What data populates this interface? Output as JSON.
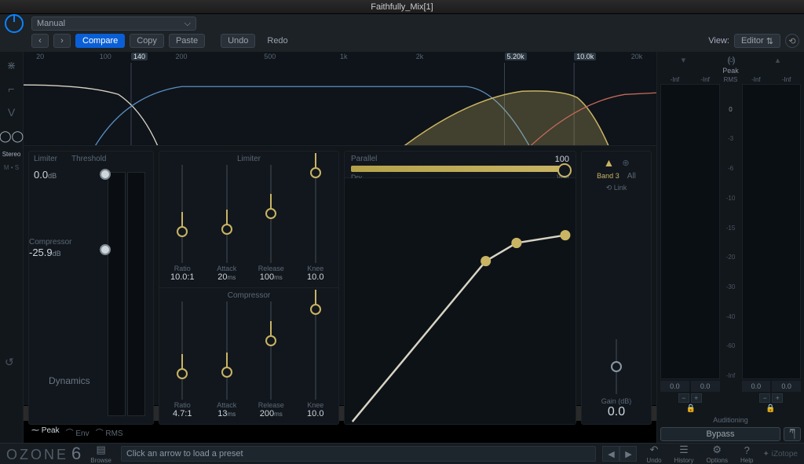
{
  "window": {
    "title": "Faithfully_Mix[1]"
  },
  "host": {
    "preset": "Manual",
    "buttons": {
      "compare": "Compare",
      "copy": "Copy",
      "paste": "Paste",
      "undo": "Undo",
      "redo": "Redo"
    },
    "view_label": "View:",
    "view_value": "Editor"
  },
  "freq": {
    "ticks": [
      {
        "pos": 2,
        "label": "20"
      },
      {
        "pos": 12,
        "label": "100"
      },
      {
        "pos": 17,
        "label": "140",
        "hot": true
      },
      {
        "pos": 24,
        "label": "200"
      },
      {
        "pos": 38,
        "label": "500"
      },
      {
        "pos": 50,
        "label": "1k"
      },
      {
        "pos": 62,
        "label": "2k"
      },
      {
        "pos": 76,
        "label": "5.20k",
        "hot": true
      },
      {
        "pos": 87,
        "label": "10.0k",
        "hot": true
      },
      {
        "pos": 96,
        "label": "20k"
      }
    ]
  },
  "threshold": {
    "section_limiter": "Limiter",
    "section_threshold": "Threshold",
    "limiter_value": "0.0",
    "limiter_unit": "dB",
    "section_compressor": "Compressor",
    "compressor_value": "-25.9",
    "compressor_unit": "dB"
  },
  "limiter": {
    "title": "Limiter",
    "params": [
      {
        "label": "Ratio",
        "value": "10.0:1"
      },
      {
        "label": "Attack",
        "value": "20",
        "unit": "ms"
      },
      {
        "label": "Release",
        "value": "100",
        "unit": "ms"
      },
      {
        "label": "Knee",
        "value": "10.0"
      }
    ]
  },
  "compressor": {
    "title": "Compressor",
    "params": [
      {
        "label": "Ratio",
        "value": "4.7:1"
      },
      {
        "label": "Attack",
        "value": "13",
        "unit": "ms"
      },
      {
        "label": "Release",
        "value": "200",
        "unit": "ms"
      },
      {
        "label": "Knee",
        "value": "10.0"
      }
    ]
  },
  "detect": {
    "peak": "Peak",
    "env": "Env",
    "rms": "RMS"
  },
  "parallel": {
    "title": "Parallel",
    "value": "100",
    "dry": "Dry",
    "wet": "Wet"
  },
  "band": {
    "band_label": "Band 3",
    "all_label": "All",
    "link": "Link",
    "gain_label": "Gain (dB)",
    "gain_value": "0.0"
  },
  "io": {
    "peak": "Peak",
    "rms": "RMS",
    "inf": "-Inf",
    "scale": [
      "0",
      "-3",
      "-6",
      "-10",
      "-15",
      "-20",
      "-30",
      "-40",
      "-60",
      "-Inf"
    ],
    "readout": "0.0",
    "auditioning": "Auditioning",
    "bypass": "Bypass"
  },
  "footer": {
    "logo_text": "OZONE",
    "logo_num": "6",
    "module": "Dynamics",
    "browse": "Browse",
    "preset_msg": "Click an arrow to load a preset",
    "undo": "Undo",
    "history": "History",
    "options": "Options",
    "help": "Help",
    "brand": "iZotope"
  },
  "caption": "iZotope Ozone 6 Dynamics",
  "stereo": {
    "label": "Stereo",
    "ms": "M • S"
  }
}
